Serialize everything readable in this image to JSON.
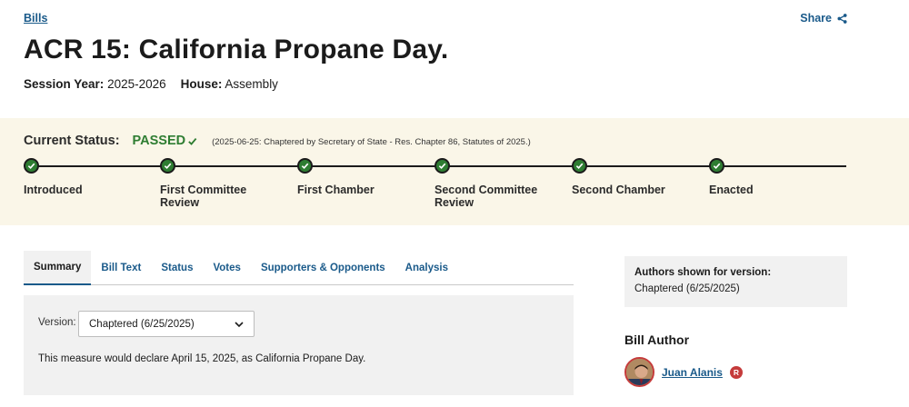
{
  "breadcrumb": {
    "label": "Bills"
  },
  "share": {
    "label": "Share",
    "icon": "share-icon"
  },
  "bill": {
    "title": "ACR 15: California Propane Day.",
    "session_year_label": "Session Year:",
    "session_year": "2025-2026",
    "house_label": "House:",
    "house": "Assembly"
  },
  "status": {
    "label": "Current Status:",
    "value": "PASSED",
    "note": "(2025-06-25: Chaptered by Secretary of State - Res. Chapter 86, Statutes of 2025.)",
    "color": "#2e7d32",
    "steps": [
      {
        "label": "Introduced"
      },
      {
        "label": "First Committee Review"
      },
      {
        "label": "First Chamber"
      },
      {
        "label": "Second Committee Review"
      },
      {
        "label": "Second Chamber"
      },
      {
        "label": "Enacted"
      }
    ]
  },
  "tabs": [
    {
      "label": "Summary",
      "active": true
    },
    {
      "label": "Bill Text"
    },
    {
      "label": "Status"
    },
    {
      "label": "Votes"
    },
    {
      "label": "Supporters & Opponents"
    },
    {
      "label": "Analysis"
    }
  ],
  "summary": {
    "version_label": "Version:",
    "version_selected": "Chaptered (6/25/2025)",
    "text": "This measure would declare April 15, 2025, as California Propane Day."
  },
  "authors": {
    "heading": "Authors shown for version:",
    "version": "Chaptered (6/25/2025)",
    "bill_author_heading": "Bill Author",
    "author_name": "Juan Alanis",
    "party": "R",
    "party_color": "#c53b3b"
  }
}
